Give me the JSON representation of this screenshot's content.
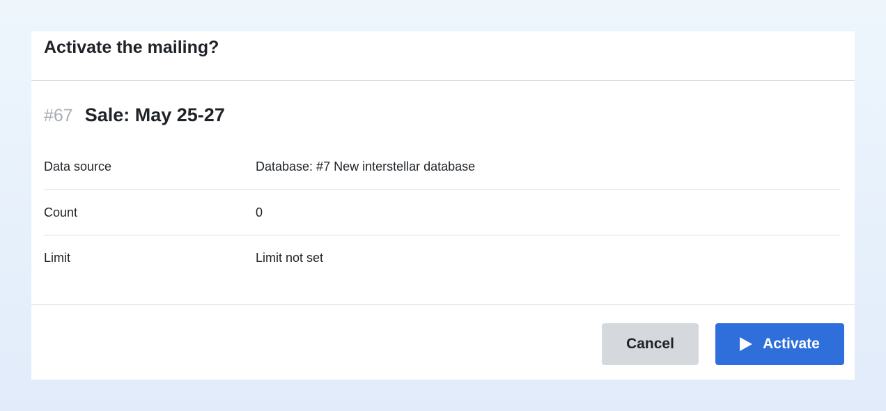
{
  "dialog": {
    "title": "Activate the mailing?"
  },
  "mailing": {
    "id": "#67",
    "name": "Sale: May 25-27"
  },
  "details": [
    {
      "label": "Data source",
      "value": "Database: #7 New interstellar database"
    },
    {
      "label": "Count",
      "value": "0"
    },
    {
      "label": "Limit",
      "value": "Limit not set"
    }
  ],
  "footer": {
    "cancel_label": "Cancel",
    "activate_label": "Activate",
    "activate_icon": "play-icon"
  },
  "colors": {
    "primary": "#2f6fdb",
    "secondary_button": "#d5d9de",
    "muted_text": "#a9adb3",
    "divider": "#d9dde3"
  }
}
